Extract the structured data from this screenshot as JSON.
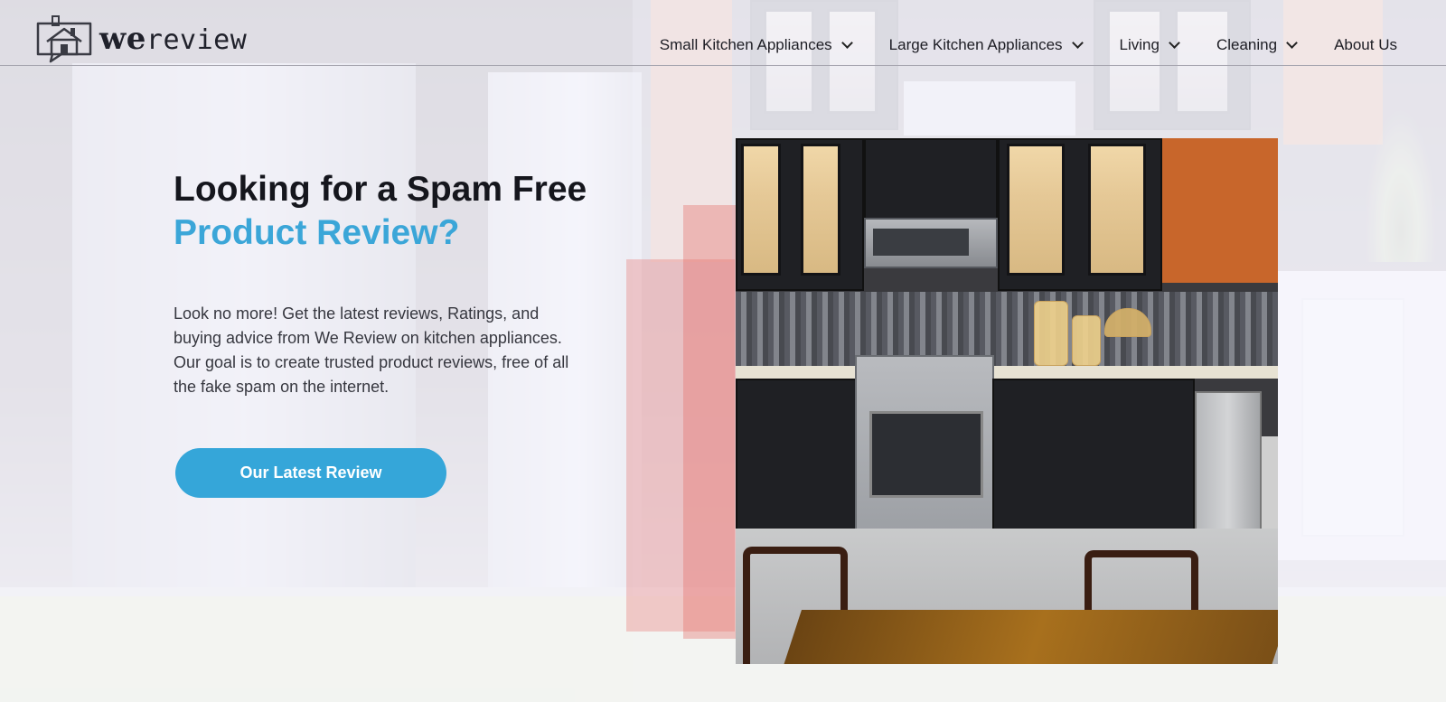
{
  "brand": {
    "name_bold": "we",
    "name_rest": "review"
  },
  "nav": {
    "items": [
      {
        "label": "Small Kitchen Appliances",
        "has_dropdown": true
      },
      {
        "label": "Large Kitchen Appliances",
        "has_dropdown": true
      },
      {
        "label": "Living",
        "has_dropdown": true
      },
      {
        "label": "Cleaning",
        "has_dropdown": true
      },
      {
        "label": "About Us",
        "has_dropdown": false
      }
    ]
  },
  "hero": {
    "title_line1": "Looking for a Spam Free",
    "title_line2": "Product Review?",
    "description": "Look no more! Get the latest reviews, Ratings, and buying advice from We Review on kitchen appliances. Our goal is to create trusted product reviews, free of all the fake spam on the internet.",
    "cta_label": "Our Latest Review"
  },
  "colors": {
    "accent": "#35a6d9",
    "text_dark": "#15161d",
    "cta_text": "#ffffff"
  },
  "icons": {
    "logo": "house-speech-bubble-icon",
    "dropdown": "chevron-down-icon"
  }
}
